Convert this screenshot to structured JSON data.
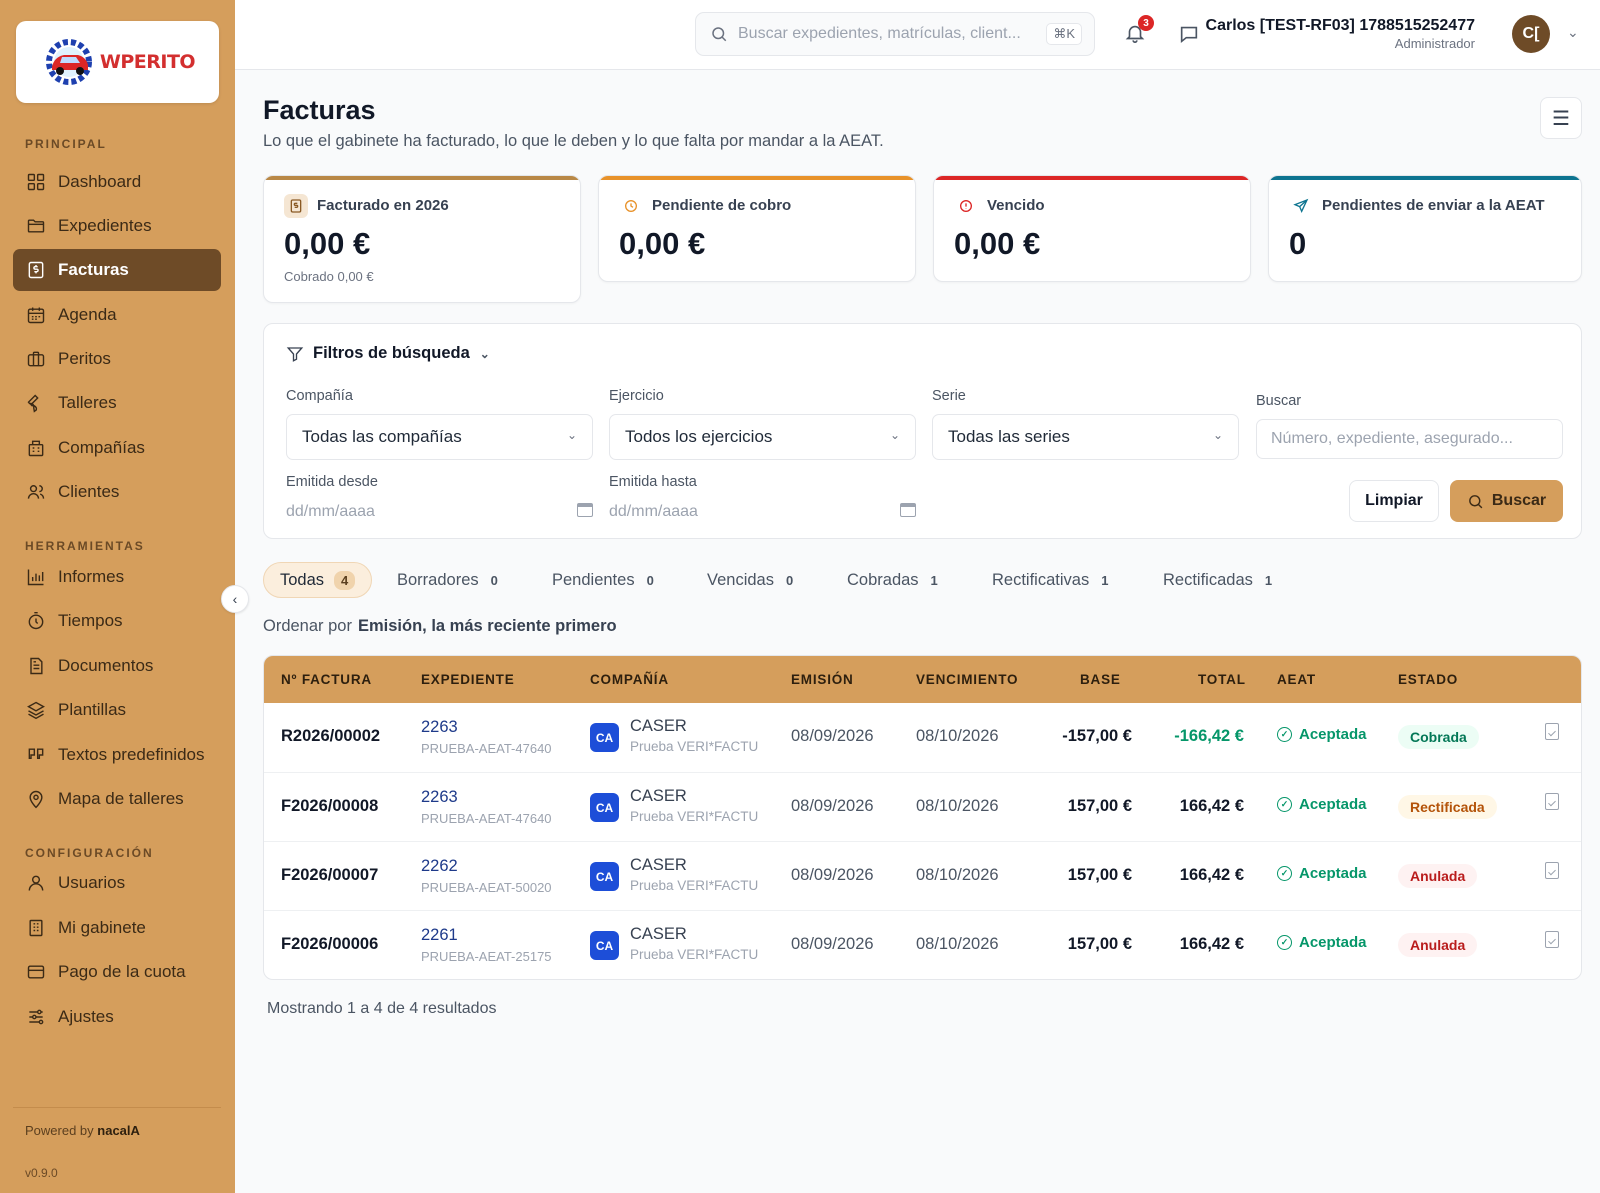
{
  "brand": {
    "logo_text": "WPERITO"
  },
  "sidebar": {
    "sections": {
      "principal": "PRINCIPAL",
      "herramientas": "HERRAMIENTAS",
      "configuracion": "CONFIGURACIÓN"
    },
    "items": [
      {
        "label": "Dashboard",
        "icon": "grid-icon"
      },
      {
        "label": "Expedientes",
        "icon": "folder-icon"
      },
      {
        "label": "Facturas",
        "icon": "invoice-icon",
        "active": true
      },
      {
        "label": "Agenda",
        "icon": "calendar-icon"
      },
      {
        "label": "Peritos",
        "icon": "briefcase-icon"
      },
      {
        "label": "Talleres",
        "icon": "wrench-icon"
      },
      {
        "label": "Compañías",
        "icon": "building-icon"
      },
      {
        "label": "Clientes",
        "icon": "users-icon"
      },
      {
        "label": "Informes",
        "icon": "bar-chart-icon"
      },
      {
        "label": "Tiempos",
        "icon": "stopwatch-icon"
      },
      {
        "label": "Documentos",
        "icon": "document-icon"
      },
      {
        "label": "Plantillas",
        "icon": "layers-icon"
      },
      {
        "label": "Textos predefinidos",
        "icon": "quote-icon"
      },
      {
        "label": "Mapa de talleres",
        "icon": "map-pin-icon"
      },
      {
        "label": "Usuarios",
        "icon": "user-icon"
      },
      {
        "label": "Mi gabinete",
        "icon": "office-icon"
      },
      {
        "label": "Pago de la cuota",
        "icon": "credit-card-icon"
      },
      {
        "label": "Ajustes",
        "icon": "sliders-icon"
      }
    ],
    "powered_prefix": "Powered by",
    "powered_brand": "nacalA",
    "version": "v0.9.0"
  },
  "topbar": {
    "search_placeholder": "Buscar expedientes, matrículas, client...",
    "shortcut": "⌘K",
    "notifications_count": "3",
    "user_name": "Carlos [TEST-RF03] 1788515252477",
    "user_role": "Administrador",
    "avatar_initials": "C["
  },
  "page": {
    "title": "Facturas",
    "subtitle": "Lo que el gabinete ha facturado, lo que le deben y lo que falta por mandar a la AEAT."
  },
  "stats": [
    {
      "label": "Facturado en 2026",
      "value": "0,00 €",
      "sub": "Cobrado 0,00 €",
      "color": "#d59e5c"
    },
    {
      "label": "Pendiente de cobro",
      "value": "0,00 €",
      "color": "#e8922a"
    },
    {
      "label": "Vencido",
      "value": "0,00 €",
      "color": "#dc2626"
    },
    {
      "label": "Pendientes de enviar a la AEAT",
      "value": "0",
      "color": "#0e7490"
    }
  ],
  "filters": {
    "title": "Filtros de búsqueda",
    "compania_label": "Compañía",
    "compania_value": "Todas las compañías",
    "ejercicio_label": "Ejercicio",
    "ejercicio_value": "Todos los ejercicios",
    "serie_label": "Serie",
    "serie_value": "Todas las series",
    "buscar_label": "Buscar",
    "buscar_placeholder": "Número, expediente, asegurado...",
    "desde_label": "Emitida desde",
    "hasta_label": "Emitida hasta",
    "date_placeholder": "dd/mm/aaaa",
    "clear_label": "Limpiar",
    "search_label": "Buscar"
  },
  "tabs": [
    {
      "label": "Todas",
      "count": "4"
    },
    {
      "label": "Borradores",
      "count": "0"
    },
    {
      "label": "Pendientes",
      "count": "0"
    },
    {
      "label": "Vencidas",
      "count": "0"
    },
    {
      "label": "Cobradas",
      "count": "1"
    },
    {
      "label": "Rectificativas",
      "count": "1"
    },
    {
      "label": "Rectificadas",
      "count": "1"
    }
  ],
  "sort": {
    "label": "Ordenar por",
    "value": "Emisión, la más reciente primero"
  },
  "table": {
    "headers": [
      "Nº FACTURA",
      "EXPEDIENTE",
      "COMPAÑÍA",
      "EMISIÓN",
      "VENCIMIENTO",
      "BASE",
      "TOTAL",
      "AEAT",
      "ESTADO"
    ],
    "rows": [
      {
        "invoice": "R2026/00002",
        "exp": "2263",
        "exp_ref": "PRUEBA-AEAT-47640",
        "comp_badge": "CA",
        "comp": "CASER",
        "comp_sub": "Prueba VERI*FACTU",
        "emision": "08/09/2026",
        "venc": "08/10/2026",
        "base": "-157,00 €",
        "total": "-166,42 €",
        "aeat": "Aceptada",
        "estado": "Cobrada"
      },
      {
        "invoice": "F2026/00008",
        "exp": "2263",
        "exp_ref": "PRUEBA-AEAT-47640",
        "comp_badge": "CA",
        "comp": "CASER",
        "comp_sub": "Prueba VERI*FACTU",
        "emision": "08/09/2026",
        "venc": "08/10/2026",
        "base": "157,00 €",
        "total": "166,42 €",
        "aeat": "Aceptada",
        "estado": "Rectificada"
      },
      {
        "invoice": "F2026/00007",
        "exp": "2262",
        "exp_ref": "PRUEBA-AEAT-50020",
        "comp_badge": "CA",
        "comp": "CASER",
        "comp_sub": "Prueba VERI*FACTU",
        "emision": "08/09/2026",
        "venc": "08/10/2026",
        "base": "157,00 €",
        "total": "166,42 €",
        "aeat": "Aceptada",
        "estado": "Anulada"
      },
      {
        "invoice": "F2026/00006",
        "exp": "2261",
        "exp_ref": "PRUEBA-AEAT-25175",
        "comp_badge": "CA",
        "comp": "CASER",
        "comp_sub": "Prueba VERI*FACTU",
        "emision": "08/09/2026",
        "venc": "08/10/2026",
        "base": "157,00 €",
        "total": "166,42 €",
        "aeat": "Aceptada",
        "estado": "Anulada"
      }
    ]
  },
  "results_text": "Mostrando 1 a 4 de 4 resultados"
}
